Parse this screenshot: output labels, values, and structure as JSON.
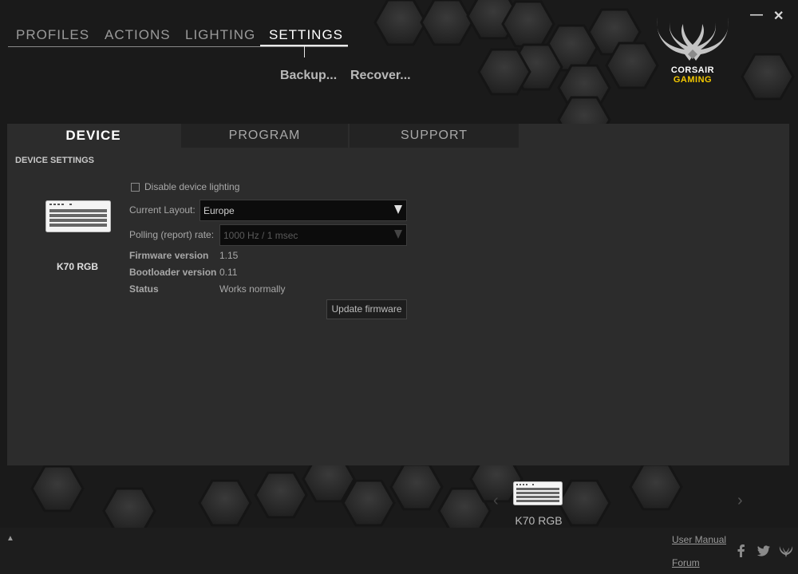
{
  "window": {
    "minimize_icon": "minimize-icon",
    "close_icon": "close-icon"
  },
  "top_nav": {
    "tabs": [
      {
        "label": "PROFILES",
        "active": false
      },
      {
        "label": "ACTIONS",
        "active": false
      },
      {
        "label": "LIGHTING",
        "active": false
      },
      {
        "label": "SETTINGS",
        "active": true
      }
    ],
    "sub_actions": [
      "Backup...",
      "Recover..."
    ]
  },
  "logo": {
    "line1": "CORSAIR",
    "line2": "GAMING",
    "brand_yellow": "#f3c800"
  },
  "panel": {
    "tabs": [
      {
        "label": "DEVICE",
        "active": true
      },
      {
        "label": "PROGRAM",
        "active": false
      },
      {
        "label": "SUPPORT",
        "active": false
      }
    ],
    "section_title": "DEVICE SETTINGS",
    "device": {
      "icon": "keyboard-icon",
      "name": "K70 RGB"
    },
    "disable_lighting": {
      "label": "Disable device lighting",
      "checked": false
    },
    "layout": {
      "label": "Current Layout:",
      "value": "Europe"
    },
    "polling": {
      "label": "Polling (report) rate:",
      "value": "1000 Hz / 1 msec",
      "disabled": true
    },
    "firmware": {
      "label": "Firmware version",
      "value": "1.15"
    },
    "bootloader": {
      "label": "Bootloader version",
      "value": "0.11"
    },
    "status": {
      "label": "Status",
      "value": "Works normally"
    },
    "update_button": "Update firmware"
  },
  "carousel": {
    "device_label": "K70 RGB",
    "device_icon": "keyboard-icon"
  },
  "footer": {
    "user_manual": "User Manual",
    "forum": "Forum",
    "social_icons": [
      "facebook-icon",
      "twitter-icon",
      "corsair-icon"
    ]
  }
}
